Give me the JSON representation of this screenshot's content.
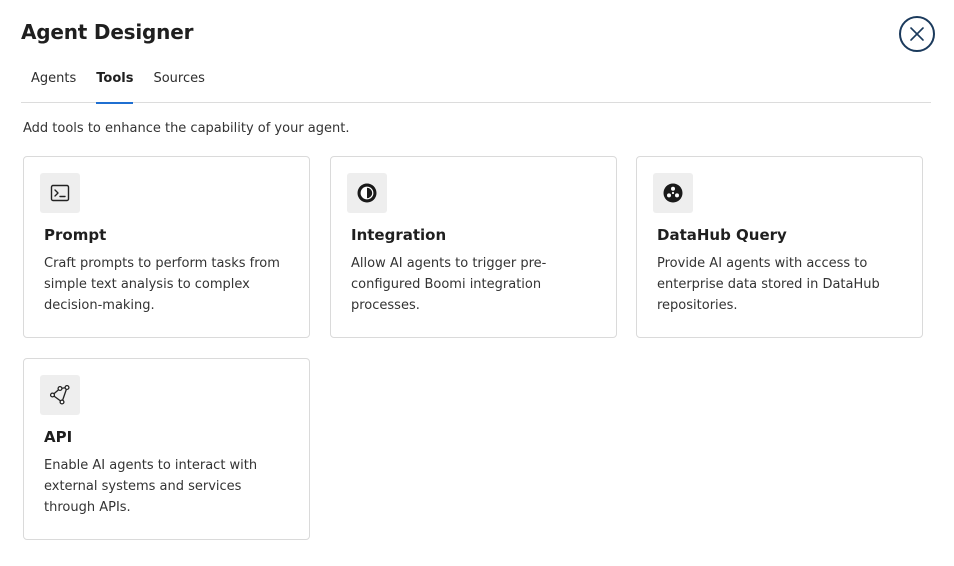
{
  "dialog": {
    "title": "Agent Designer",
    "close_icon": "close-icon"
  },
  "tabs": [
    {
      "label": "Agents",
      "active": false
    },
    {
      "label": "Tools",
      "active": true
    },
    {
      "label": "Sources",
      "active": false
    }
  ],
  "subtitle": "Add tools to enhance the capability of your agent.",
  "tools": [
    {
      "icon": "terminal-icon",
      "title": "Prompt",
      "description": "Craft prompts to perform tasks from simple text analysis to complex decision-making."
    },
    {
      "icon": "integration-icon",
      "title": "Integration",
      "description": "Allow AI agents to trigger pre-configured Boomi integration processes."
    },
    {
      "icon": "datahub-icon",
      "title": "DataHub Query",
      "description": "Provide AI agents with access to enterprise data stored in DataHub repositories."
    },
    {
      "icon": "api-icon",
      "title": "API",
      "description": "Enable AI agents to interact with external systems and services through APIs."
    }
  ],
  "colors": {
    "accent": "#1f6fd1",
    "close_border": "#1b3a5c",
    "card_border": "#dadada",
    "icon_bg": "#eeeeee"
  }
}
